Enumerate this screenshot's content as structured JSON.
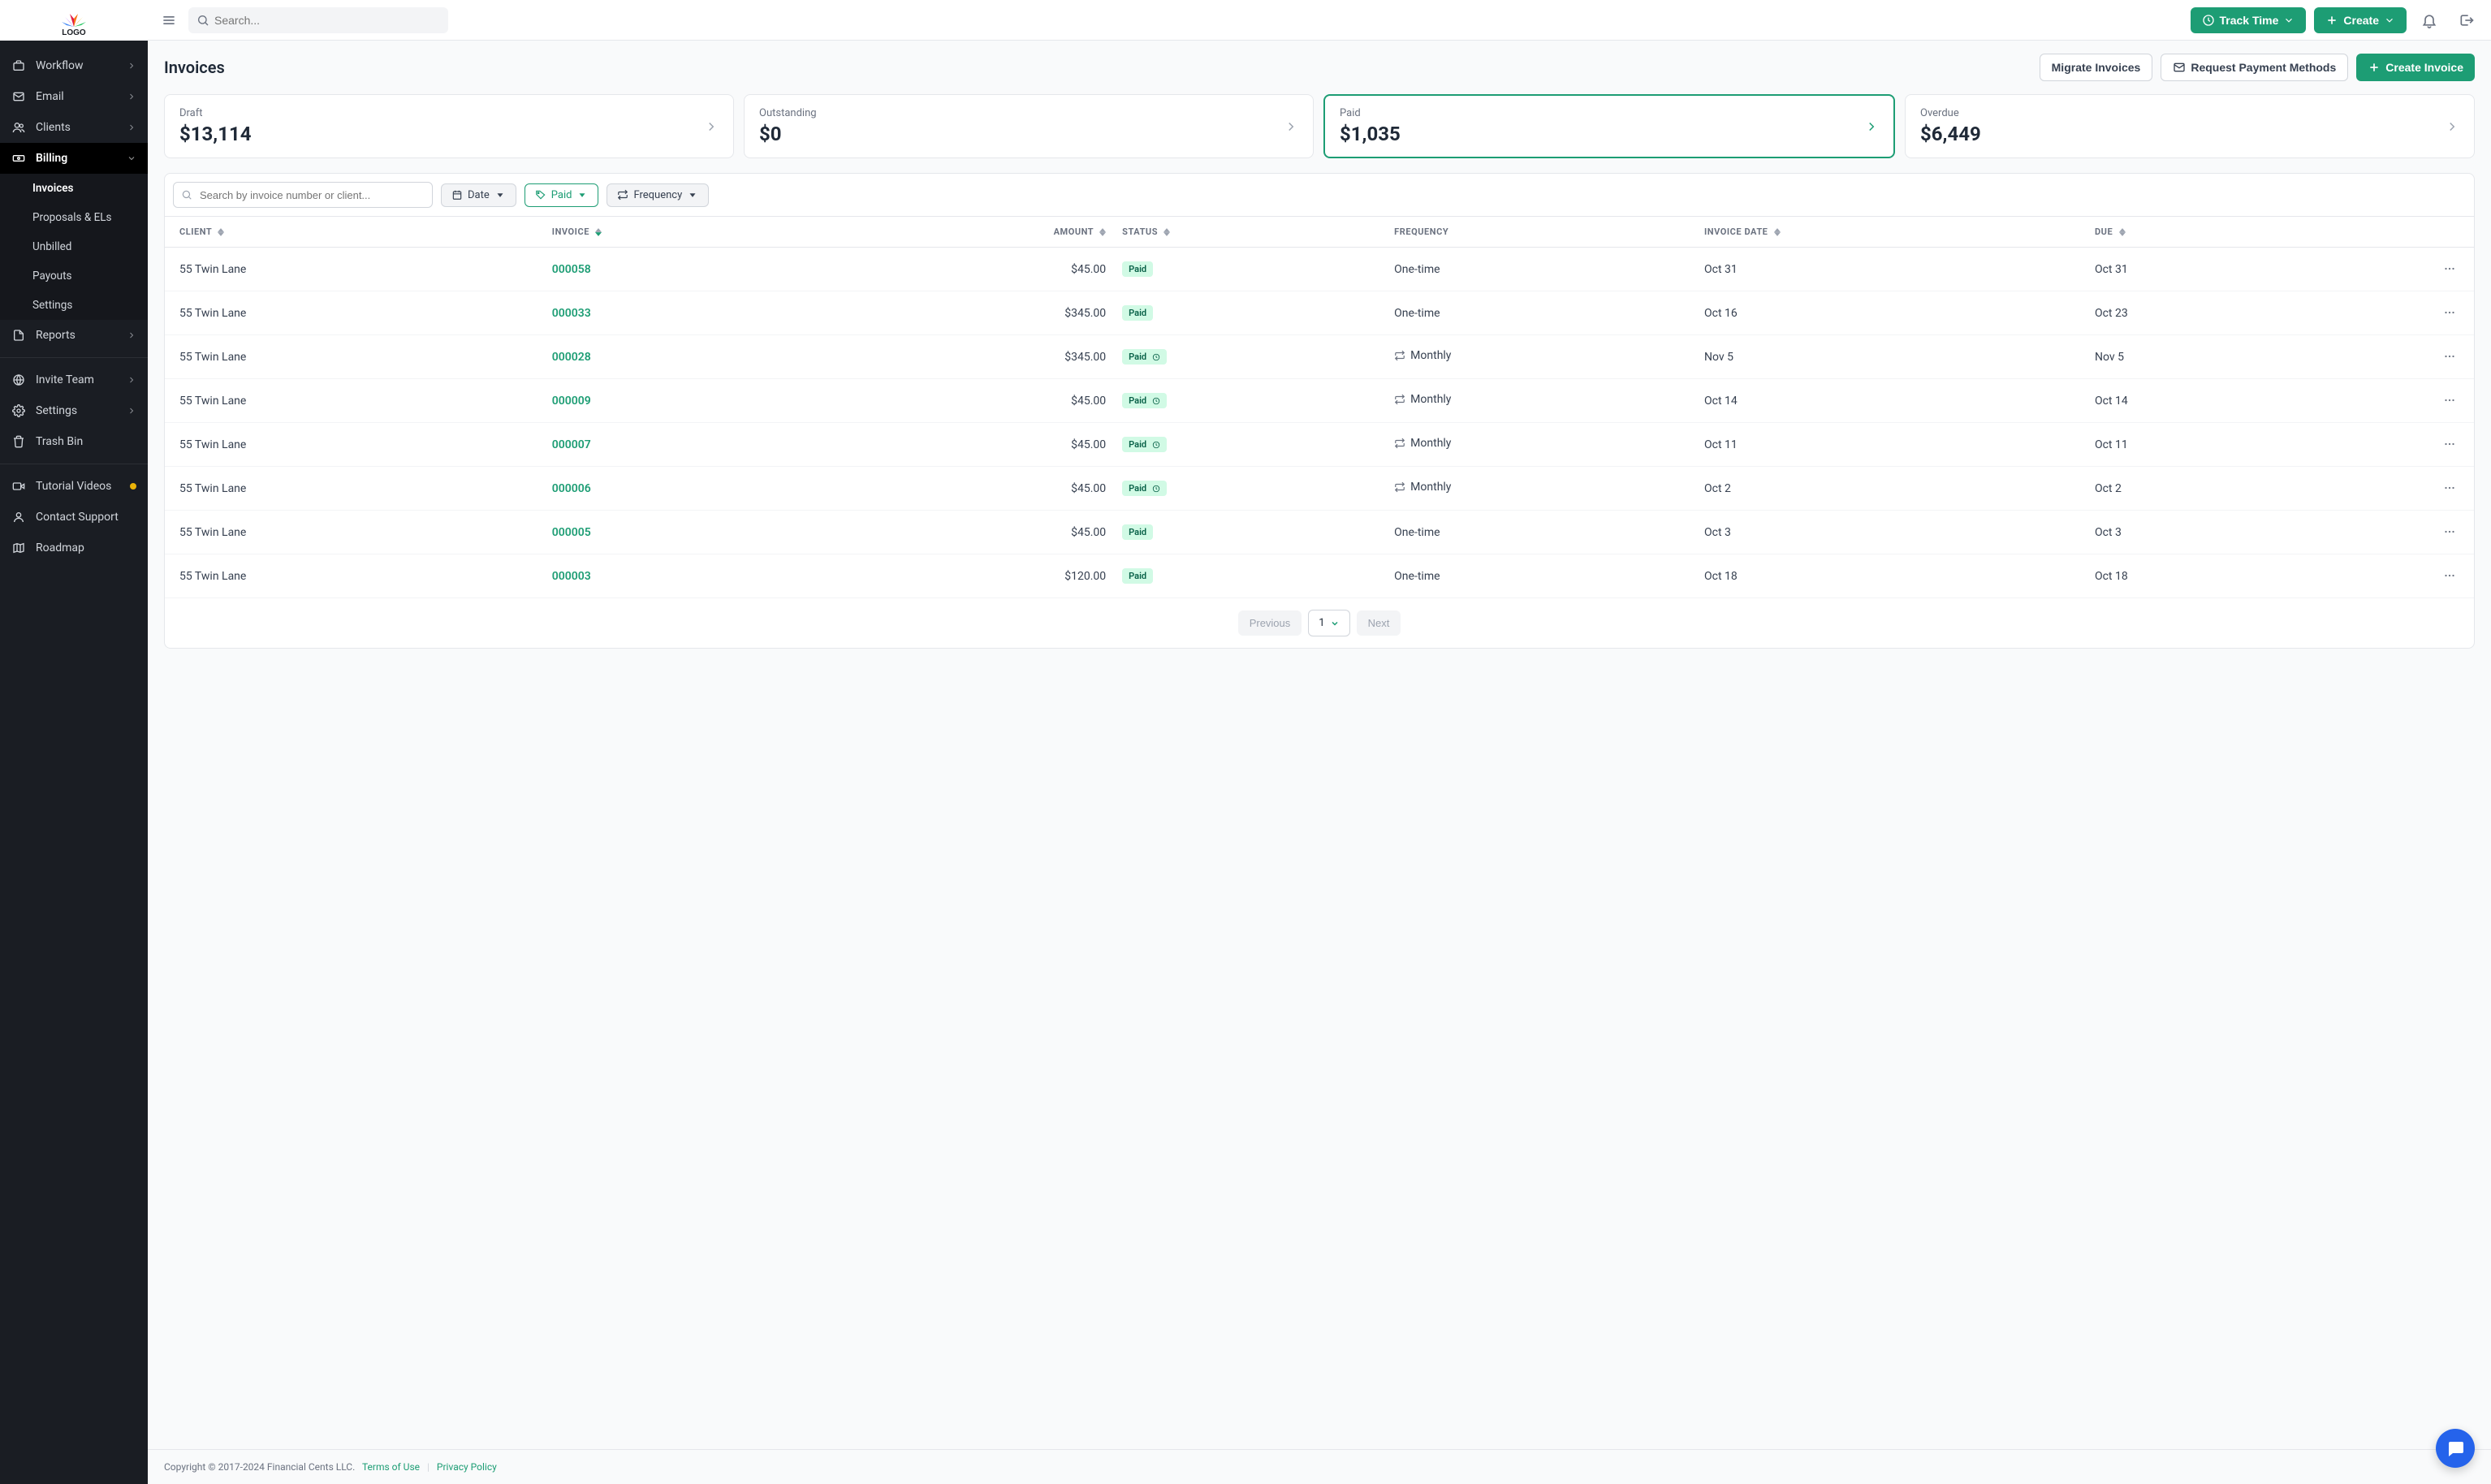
{
  "topbar": {
    "search_placeholder": "Search...",
    "track_time": "Track Time",
    "create": "Create"
  },
  "sidebar": {
    "items": [
      {
        "label": "Workflow"
      },
      {
        "label": "Email"
      },
      {
        "label": "Clients"
      },
      {
        "label": "Billing"
      },
      {
        "label": "Reports"
      },
      {
        "label": "Invite Team"
      },
      {
        "label": "Settings"
      },
      {
        "label": "Trash Bin"
      },
      {
        "label": "Tutorial Videos"
      },
      {
        "label": "Contact Support"
      },
      {
        "label": "Roadmap"
      }
    ],
    "billing_sub": [
      {
        "label": "Invoices"
      },
      {
        "label": "Proposals & ELs"
      },
      {
        "label": "Unbilled"
      },
      {
        "label": "Payouts"
      },
      {
        "label": "Settings"
      }
    ]
  },
  "page": {
    "title": "Invoices",
    "migrate": "Migrate Invoices",
    "request_pm": "Request Payment Methods",
    "create_invoice": "Create Invoice"
  },
  "stats": [
    {
      "label": "Draft",
      "value": "$13,114"
    },
    {
      "label": "Outstanding",
      "value": "$0"
    },
    {
      "label": "Paid",
      "value": "$1,035"
    },
    {
      "label": "Overdue",
      "value": "$6,449"
    }
  ],
  "filters": {
    "search_placeholder": "Search by invoice number or client...",
    "date": "Date",
    "paid": "Paid",
    "frequency": "Frequency"
  },
  "columns": {
    "client": "CLIENT",
    "invoice": "INVOICE",
    "amount": "AMOUNT",
    "status": "STATUS",
    "frequency": "FREQUENCY",
    "invoice_date": "INVOICE DATE",
    "due": "DUE"
  },
  "rows": [
    {
      "client": "55 Twin Lane",
      "invoice": "000058",
      "amount": "$45.00",
      "status": "Paid",
      "recurring": false,
      "freq": "One-time",
      "date": "Oct 31",
      "due": "Oct 31"
    },
    {
      "client": "55 Twin Lane",
      "invoice": "000033",
      "amount": "$345.00",
      "status": "Paid",
      "recurring": false,
      "freq": "One-time",
      "date": "Oct 16",
      "due": "Oct 23"
    },
    {
      "client": "55 Twin Lane",
      "invoice": "000028",
      "amount": "$345.00",
      "status": "Paid",
      "recurring": true,
      "status_clock": true,
      "freq": "Monthly",
      "date": "Nov 5",
      "due": "Nov 5"
    },
    {
      "client": "55 Twin Lane",
      "invoice": "000009",
      "amount": "$45.00",
      "status": "Paid",
      "recurring": true,
      "status_clock": true,
      "freq": "Monthly",
      "date": "Oct 14",
      "due": "Oct 14"
    },
    {
      "client": "55 Twin Lane",
      "invoice": "000007",
      "amount": "$45.00",
      "status": "Paid",
      "recurring": true,
      "status_clock": true,
      "freq": "Monthly",
      "date": "Oct 11",
      "due": "Oct 11"
    },
    {
      "client": "55 Twin Lane",
      "invoice": "000006",
      "amount": "$45.00",
      "status": "Paid",
      "recurring": true,
      "status_clock": true,
      "freq": "Monthly",
      "date": "Oct 2",
      "due": "Oct 2"
    },
    {
      "client": "55 Twin Lane",
      "invoice": "000005",
      "amount": "$45.00",
      "status": "Paid",
      "recurring": false,
      "freq": "One-time",
      "date": "Oct 3",
      "due": "Oct 3"
    },
    {
      "client": "55 Twin Lane",
      "invoice": "000003",
      "amount": "$120.00",
      "status": "Paid",
      "recurring": false,
      "freq": "One-time",
      "date": "Oct 18",
      "due": "Oct 18"
    }
  ],
  "pagination": {
    "prev": "Previous",
    "page": "1",
    "next": "Next"
  },
  "footer": {
    "copyright": "Copyright © 2017-2024 Financial Cents LLC.",
    "terms": "Terms of Use",
    "privacy": "Privacy Policy"
  }
}
